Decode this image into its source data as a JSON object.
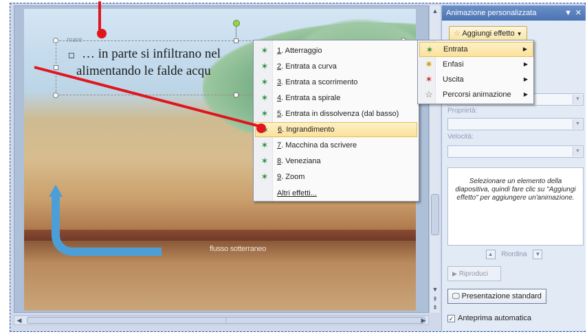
{
  "slide": {
    "label_mare": "mare",
    "text_line1": "… in parte si infiltrano nel",
    "text_line2": "alimentando le falde acqu",
    "label_flow": "flusso sotterraneo"
  },
  "effects_menu": {
    "items": [
      {
        "num": "1",
        "label": ". Atterraggio",
        "icon": "star-green-icon"
      },
      {
        "num": "2",
        "label": ". Entrata a curva",
        "icon": "star-green-icon"
      },
      {
        "num": "3",
        "label": ". Entrata a scorrimento",
        "icon": "star-green-icon"
      },
      {
        "num": "4",
        "label": ". Entrata a spirale",
        "icon": "star-green-icon"
      },
      {
        "num": "5",
        "label": ". Entrata in dissolvenza (dal basso)",
        "icon": "star-green-icon"
      },
      {
        "num": "6",
        "label": ". Ingrandimento",
        "icon": "star-green-icon"
      },
      {
        "num": "7",
        "label": ". Macchina da scrivere",
        "icon": "star-green-icon"
      },
      {
        "num": "8",
        "label": ". Veneziana",
        "icon": "star-green-icon"
      },
      {
        "num": "9",
        "label": ". Zoom",
        "icon": "star-green-icon"
      }
    ],
    "more_label": "Altri effetti...",
    "highlighted_index": 5
  },
  "submenu": {
    "items": [
      {
        "label": "Entrata",
        "icon": "entrance-star-icon"
      },
      {
        "label": "Enfasi",
        "icon": "emphasis-star-icon"
      },
      {
        "label": "Uscita",
        "icon": "exit-star-icon"
      },
      {
        "label": "Percorsi animazione",
        "icon": "motion-path-star-icon"
      }
    ],
    "highlighted_index": 0
  },
  "pane": {
    "title": "Animazione personalizzata",
    "add_effect": "Aggiungi effetto",
    "property_label": "Proprietà:",
    "speed_label": "Velocità:",
    "info_text": "Selezionare un elemento della diapositiva, quindi fare clic su \"Aggiungi effetto\" per aggiungere un'animazione.",
    "reorder_label": "Riordina",
    "play_label": "Riproduci",
    "slideshow_label": "Presentazione standard",
    "autopreview_label": "Anteprima automatica",
    "autopreview_checked": true
  },
  "colors": {
    "annotation_red": "#e0161d",
    "highlight": "#fbe19a",
    "pane_header": "#4a73b3"
  }
}
